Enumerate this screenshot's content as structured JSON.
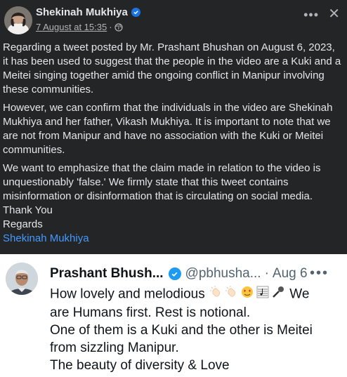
{
  "post": {
    "author": "Shekinah Mukhiya",
    "timestamp": "7 August at 15:35",
    "separator": "·",
    "paragraphs": {
      "p1": "Regarding a tweet posted by Mr. Prashant Bhushan on August 6, 2023, it has been used to suggest that the people in the video are a Kuki and a Meitei singing together amid the ongoing conflict in Manipur involving these communities.",
      "p2": "However, we can confirm that the individuals in the video are Shekinah Mukhiya and her father, Vikash Mukhiya. It is important to note that we are not from Manipur and have no association with the Kuki or Meitei communities.",
      "p3": "We want to emphasize that the claim made in relation to the video is unquestionably 'false.' We firmly state that this tweet contains misinformation or disinformation that is circulating on social media.",
      "thanks": "Thank You",
      "regards": "Regards",
      "signature": "Shekinah Mukhiya"
    },
    "more_icon": "more-horizontal-icon",
    "close_icon": "close-icon",
    "audience_icon": "globe-icon",
    "colors": {
      "background": "#242526",
      "text": "#e4e6eb",
      "link": "#4599ff",
      "verified": "#1b74e4"
    }
  },
  "tweet": {
    "name": "Prashant Bhush...",
    "handle": "@pbhusha...",
    "separator": "·",
    "date": "Aug 6",
    "lines": {
      "l1_text": "How lovely and  melodious",
      "l1_tail": "We",
      "l2": "are Humans first. Rest is notional.",
      "l3": "One of them is a Kuki and the other is Meitei",
      "l4": "from sizzling Manipur.",
      "l5": "The beauty of diversity & Love"
    },
    "emojis": [
      "clapping-hands-icon",
      "clapping-hands-icon",
      "face-with-heart-eyes-icon",
      "musical-score-icon",
      "microphone-icon"
    ],
    "colors": {
      "background": "#ffffff",
      "text": "#0f1419",
      "secondary": "#536471",
      "verified": "#1d9bf0"
    }
  }
}
